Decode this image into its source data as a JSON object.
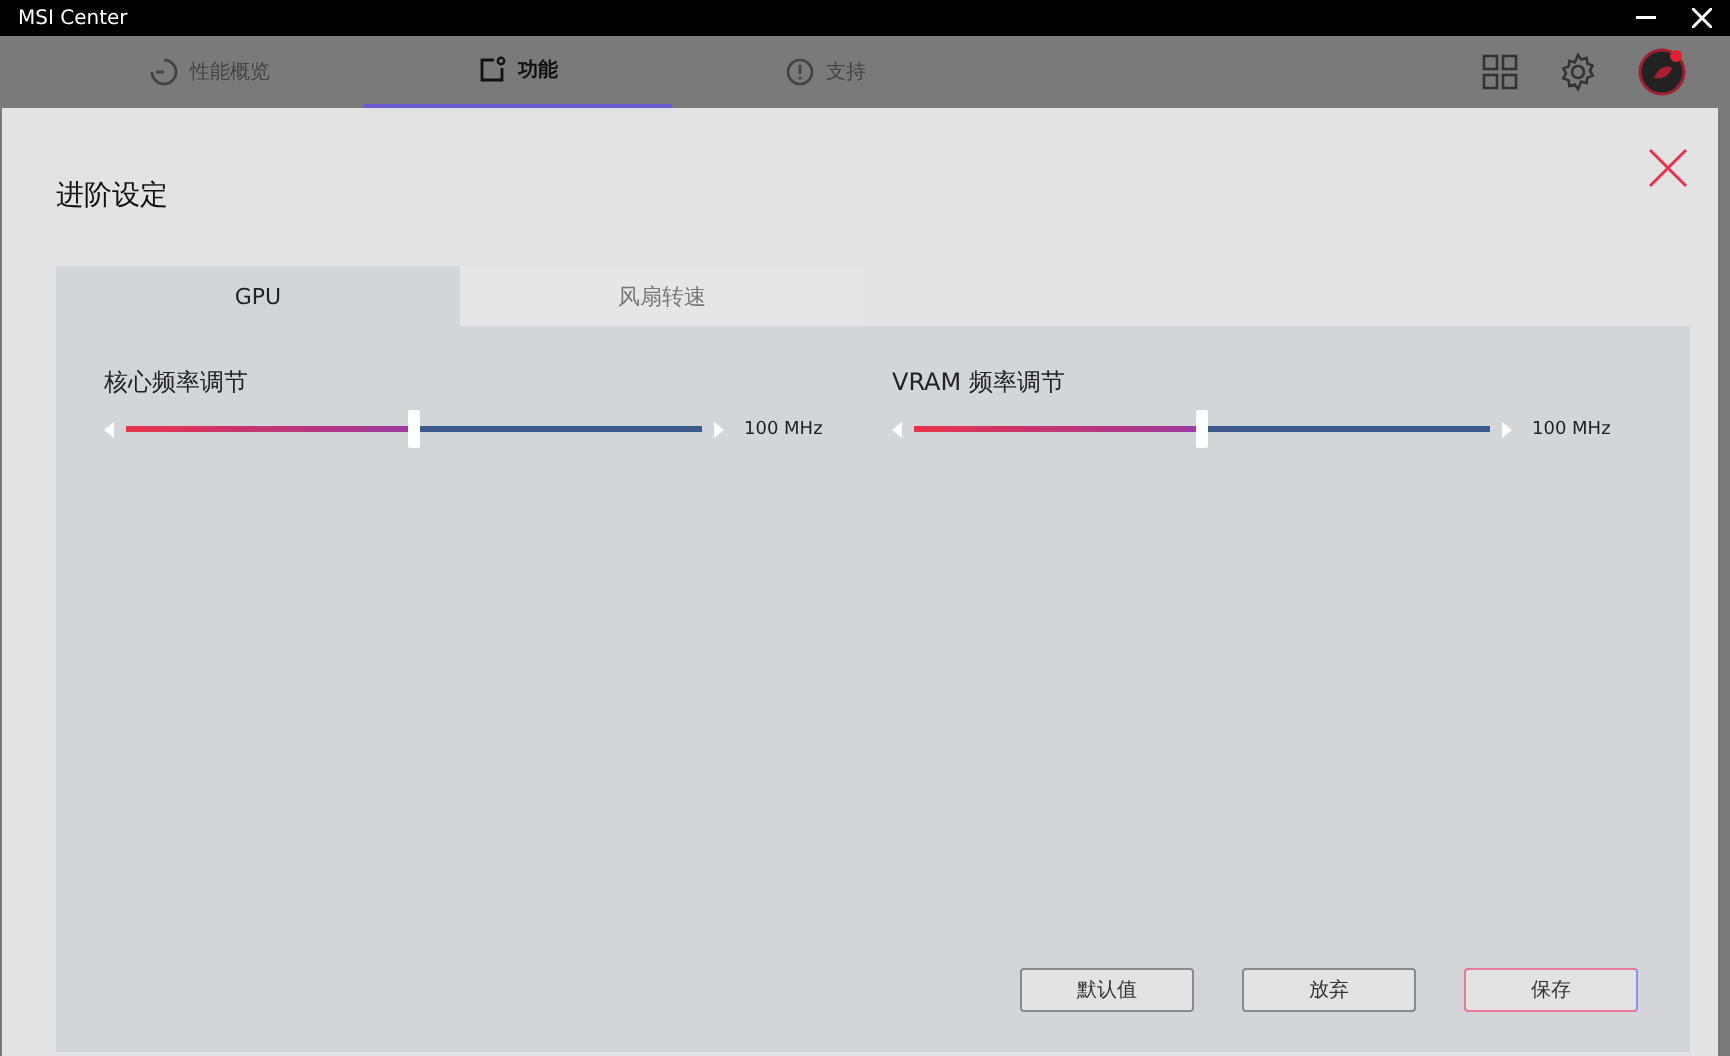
{
  "window": {
    "title": "MSI Center"
  },
  "nav_tabs": [
    {
      "label": "性能概览",
      "selected": false
    },
    {
      "label": "功能",
      "selected": true
    },
    {
      "label": "支持",
      "selected": false
    }
  ],
  "dialog": {
    "title": "进阶设定",
    "tabs": [
      {
        "label": "GPU",
        "selected": true
      },
      {
        "label": "风扇转速",
        "selected": false
      }
    ],
    "sliders": [
      {
        "label": "核心频率调节",
        "level": 0.5,
        "reading": "100 MHz"
      },
      {
        "label": "VRAM 频率调节",
        "level": 0.5,
        "reading": "100 MHz"
      }
    ],
    "buttons": [
      {
        "label": "默认值",
        "primary": false
      },
      {
        "label": "放弃",
        "primary": false
      },
      {
        "label": "保存",
        "primary": true
      }
    ]
  }
}
